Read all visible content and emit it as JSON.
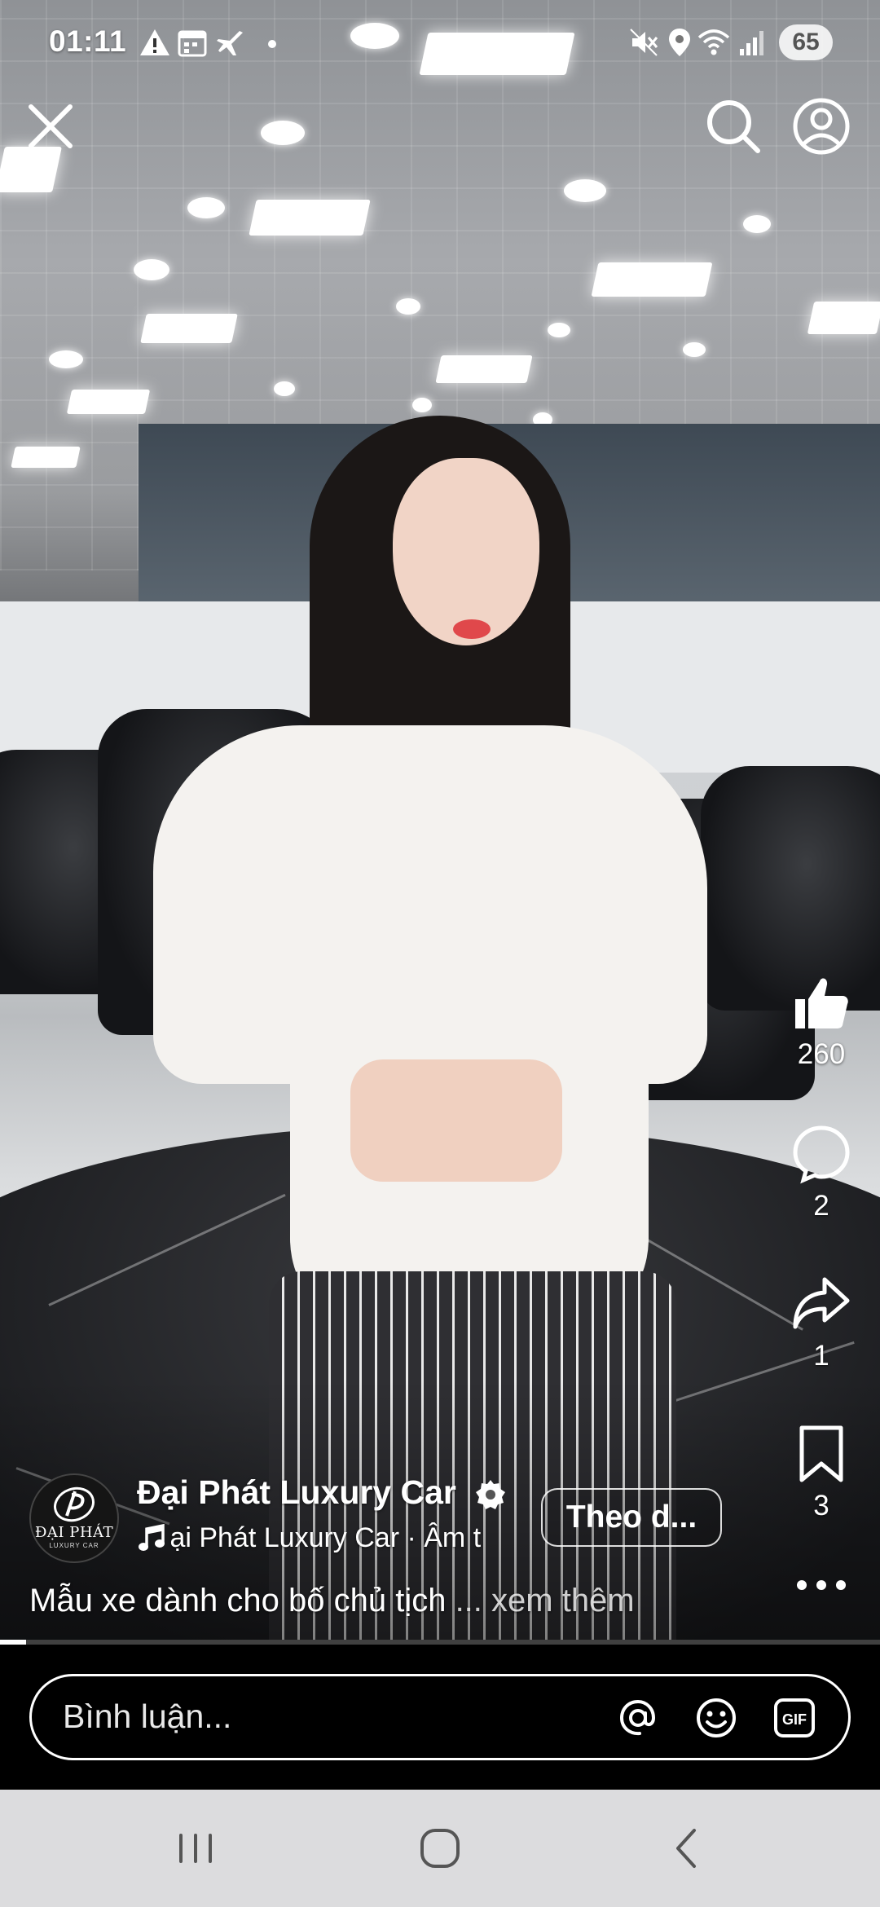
{
  "status_bar": {
    "time": "01:11",
    "battery": "65",
    "left_icons": [
      "warning-icon",
      "calendar-icon",
      "plane-notification-icon",
      "dot-icon"
    ],
    "right_icons": [
      "mute-icon",
      "location-icon",
      "wifi-icon",
      "signal-icon"
    ]
  },
  "top_bar": {
    "close_icon": "close-icon",
    "search_icon": "search-icon",
    "profile_icon": "profile-icon"
  },
  "actions": {
    "like_count": "260",
    "comment_count": "2",
    "share_count": "1",
    "save_count": "3"
  },
  "post": {
    "author_name": "Đại Phát Luxury Car",
    "avatar_text": "ĐẠI PHÁT",
    "avatar_subtext": "LUXURY CAR",
    "audio_label": "ại Phát Luxury Car · Âm t",
    "follow_label": "Theo d...",
    "caption_text": "Mẫu xe dành cho bố chủ tịch",
    "caption_more": " ... xem thêm",
    "progress": 0.03
  },
  "comment_bar": {
    "placeholder": "Bình luận...",
    "icons": [
      "mention-icon",
      "emoji-icon",
      "gif-icon"
    ]
  },
  "colors": {
    "accent": "#ffffff",
    "nav_background": "#dcdcde",
    "comment_background": "#000000"
  }
}
